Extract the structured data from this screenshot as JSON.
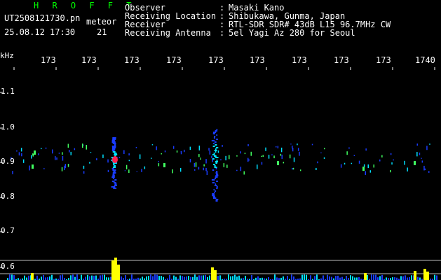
{
  "header": {
    "brand": "H R O F F T",
    "filename": "UT2508121730.pn",
    "meteor_label": "meteor",
    "datetime": "25.08.12 17:30",
    "meteor_count": "21",
    "fields": [
      {
        "label": "Observer",
        "value": "Masaki Kano"
      },
      {
        "label": "Receiving Location",
        "value": "Shibukawa, Gunma, Japan"
      },
      {
        "label": "Receiver",
        "value": "RTL-SDR SDR# 43dB L15 96.7MHz CW"
      },
      {
        "label": "Receiving Antenna",
        "value": "5el Yagi Az 280 for Seoul"
      }
    ],
    "separator": ":"
  },
  "axis": {
    "unit": "kHz",
    "y_ticks": [
      "1.1",
      "1.0",
      "0.9",
      "0.8",
      "0.7",
      "0.6"
    ],
    "x_ticks": [
      "173",
      "173",
      "173",
      "173",
      "173",
      "173",
      "173",
      "173",
      "173",
      "1740"
    ]
  },
  "colors": {
    "background": "#000000",
    "header_green": "#00ff00",
    "text_white": "#ffffff",
    "trace_blue": "#1a3cff",
    "trace_cyan": "#00e0ff",
    "trace_green": "#40ff60",
    "trace_yellow": "#ffff00",
    "trace_red": "#ff2050"
  }
}
